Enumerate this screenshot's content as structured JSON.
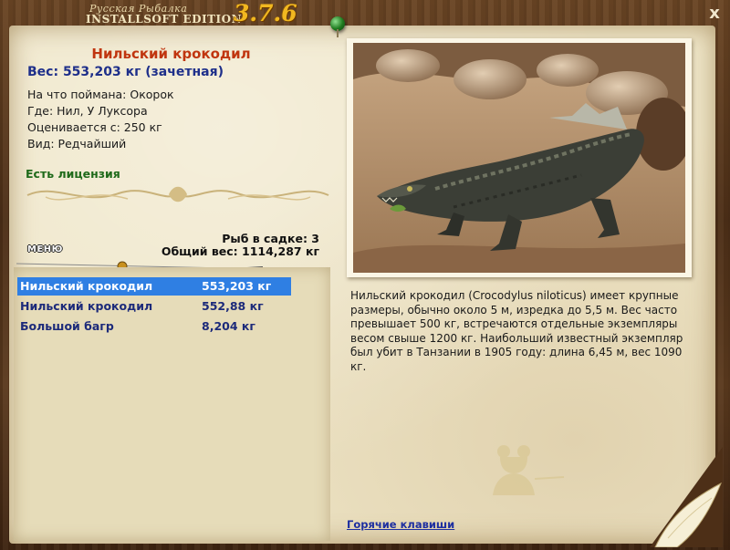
{
  "window": {
    "title_small": "Русская Рыбалка",
    "title_big": "INSTALLSOFT EDITION",
    "version": "3.7.6",
    "close_label": "x"
  },
  "fish": {
    "name": "Нильский крокодил",
    "weight": "Вес: 553,203 кг (зачетная)",
    "caught_on": "На что поймана: Окорок",
    "where": "Где: Нил, У Луксора",
    "rated_from": "Оценивается с: 250 кг",
    "kind": "Вид: Редчайший",
    "license": "Есть лицензия"
  },
  "stats": {
    "in_keepnet": "Рыб в садке: 3",
    "total_weight": "Общий вес: 1114,287 кг"
  },
  "menu_label": "МЕНЮ",
  "catch_list": [
    {
      "name": "Нильский крокодил",
      "weight": "553,203 кг",
      "selected": true
    },
    {
      "name": "Нильский крокодил",
      "weight": "552,88 кг",
      "selected": false
    },
    {
      "name": "Большой багр",
      "weight": "8,204 кг",
      "selected": false
    }
  ],
  "description": "Нильский крокодил (Crocodylus niloticus) имеет крупные размеры, обычно около 5 м, изредка до 5,5 м. Вес часто превышает 500 кг, встречаются отдельные экземпляры весом свыше 1200 кг. Наибольший известный экземпляр был убит в Танзании в 1905 году: длина 6,45 м, вес 1090 кг.",
  "hotkeys_label": "Горячие клавиши",
  "colors": {
    "fish_name": "#c0350f",
    "weight": "#1e2f8a",
    "license": "#1f6a1a",
    "selected_row": "#2f7fe3",
    "version": "#f2b820"
  },
  "icons": {
    "close": "close-icon",
    "pin": "green-pin-icon",
    "watermark": "fisherman-watermark-icon"
  }
}
